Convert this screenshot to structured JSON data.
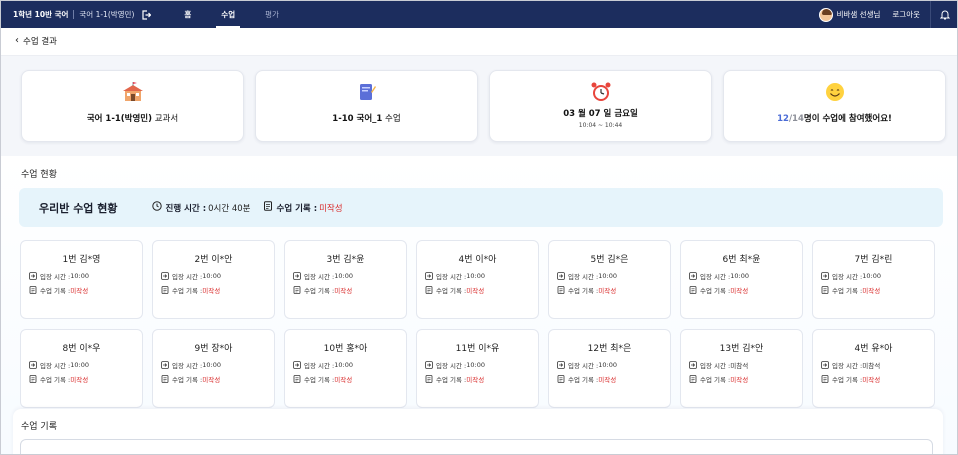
{
  "topbar": {
    "class_name": "1학년 10반 국어",
    "subject": "국어 1-1(박영민)",
    "nav": [
      {
        "label": "홈",
        "active": false
      },
      {
        "label": "수업",
        "active": true
      },
      {
        "label": "평가",
        "active": false
      }
    ],
    "user_name": "비바샘 선생님",
    "logout_label": "로그아웃"
  },
  "breadcrumb": {
    "back_label": "수업 결과"
  },
  "info_cards": {
    "textbook": {
      "name": "국어 1-1(박영민)",
      "suffix": " 교과서",
      "icon": "school-icon"
    },
    "lesson": {
      "name": "1-10 국어_1",
      "suffix": " 수업",
      "icon": "notebook-icon"
    },
    "date": {
      "main": "03 월 07 일 금요일",
      "time": "10:04 ~ 10:44",
      "icon": "alarm-clock-icon"
    },
    "participation": {
      "joined": "12",
      "slash": "/",
      "total": "14",
      "text": "명이 수업에 참여했어요!",
      "icon": "smile-icon"
    }
  },
  "status_section": {
    "title": "수업 현황",
    "box_title": "우리반 수업 현황",
    "elapsed_label": "진행 시간 :",
    "elapsed_value": "0시간 40분",
    "record_label": "수업 기록 :",
    "record_value": "미작성"
  },
  "labels": {
    "entry": "입장 시간 : ",
    "record": "수업 기록 : "
  },
  "students": [
    {
      "name": "1번 김*영",
      "entry": "10:00",
      "record": "미작성"
    },
    {
      "name": "2번 이*안",
      "entry": "10:00",
      "record": "미작성"
    },
    {
      "name": "3번 김*윤",
      "entry": "10:00",
      "record": "미작성"
    },
    {
      "name": "4번 이*아",
      "entry": "10:00",
      "record": "미작성"
    },
    {
      "name": "5번 김*은",
      "entry": "10:00",
      "record": "미작성"
    },
    {
      "name": "6번 최*윤",
      "entry": "10:00",
      "record": "미작성"
    },
    {
      "name": "7번 김*린",
      "entry": "10:00",
      "record": "미작성"
    },
    {
      "name": "8번 이*우",
      "entry": "10:00",
      "record": "미작성"
    },
    {
      "name": "9번 장*아",
      "entry": "10:00",
      "record": "미작성"
    },
    {
      "name": "10번 홍*아",
      "entry": "10:00",
      "record": "미작성"
    },
    {
      "name": "11번 이*유",
      "entry": "10:00",
      "record": "미작성"
    },
    {
      "name": "12번 최*은",
      "entry": "10:00",
      "record": "미작성"
    },
    {
      "name": "13번 김*안",
      "entry": "미참석",
      "record": "미작성"
    },
    {
      "name": "4번 유*아",
      "entry": "미참석",
      "record": "미작성"
    }
  ],
  "log_section": {
    "title": "수업 기록"
  },
  "colors": {
    "topbar": "#1c2d5e",
    "status_bg": "#e6f4fb",
    "alert_red": "#d92b2b",
    "accent_blue": "#4a6bd6"
  }
}
